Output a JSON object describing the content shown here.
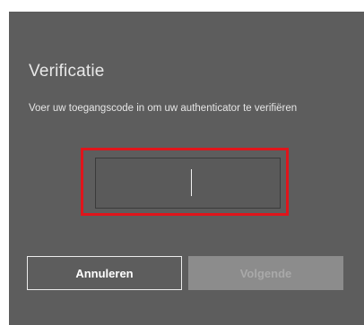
{
  "dialog": {
    "title": "Verificatie",
    "description": "Voer uw toegangscode in om uw authenticator te verifiëren",
    "code_input": {
      "value": "",
      "placeholder": ""
    },
    "buttons": {
      "cancel_label": "Annuleren",
      "next_label": "Volgende"
    }
  },
  "colors": {
    "dialog_bg": "#5d5d5d",
    "highlight": "#e0151b",
    "disabled_button_bg": "#8c8c8c"
  }
}
